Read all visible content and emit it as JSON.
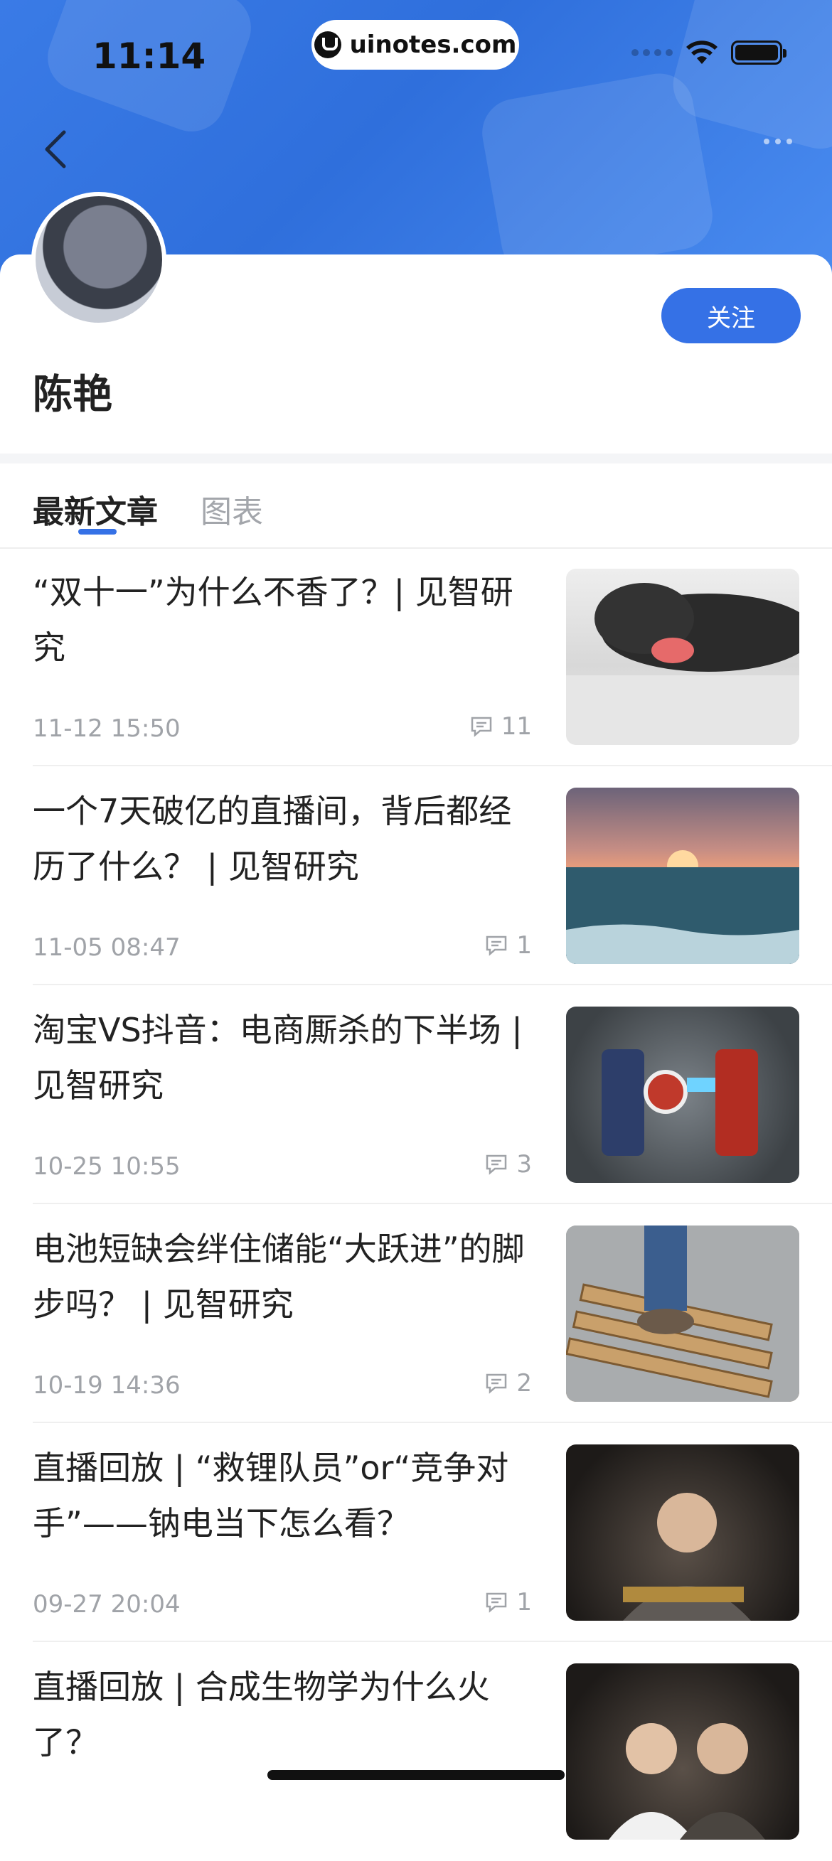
{
  "status_bar": {
    "time": "11:14",
    "url": "uinotes.com"
  },
  "profile": {
    "name": "陈艳",
    "follow_label": "关注"
  },
  "tabs": [
    {
      "label": "最新文章",
      "active": true
    },
    {
      "label": "图表",
      "active": false
    }
  ],
  "articles": [
    {
      "title": "“双十一”为什么不香了？| 见智研究",
      "time": "11-12 15:50",
      "comments": "11",
      "thumb": "pug-yawning-image"
    },
    {
      "title": "一个7天破亿的直播间，背后都经历了什么？ | 见智研究",
      "time": "11-05 08:47",
      "comments": "1",
      "thumb": "sunset-sea-image"
    },
    {
      "title": "淘宝VS抖音：电商厮杀的下半场 | 见智研究",
      "time": "10-25 10:55",
      "comments": "3",
      "thumb": "lego-heroes-image"
    },
    {
      "title": "电池短缺会绊住储能“大跃进”的脚步吗？ | 见智研究",
      "time": "10-19 14:36",
      "comments": "2",
      "thumb": "wooden-pallet-image"
    },
    {
      "title": "直播回放 | “救锂队员”or“竞争对手”——钠电当下怎么看？",
      "time": "09-27 20:04",
      "comments": "1",
      "thumb": "livestream-guest-image"
    },
    {
      "title": "直播回放 | 合成生物学为什么火了？",
      "time": "",
      "comments": "",
      "thumb": "livestream-hosts-image"
    }
  ],
  "colors": {
    "accent": "#3571e6",
    "header": "#3a7be6",
    "muted": "#a0a3a8"
  }
}
